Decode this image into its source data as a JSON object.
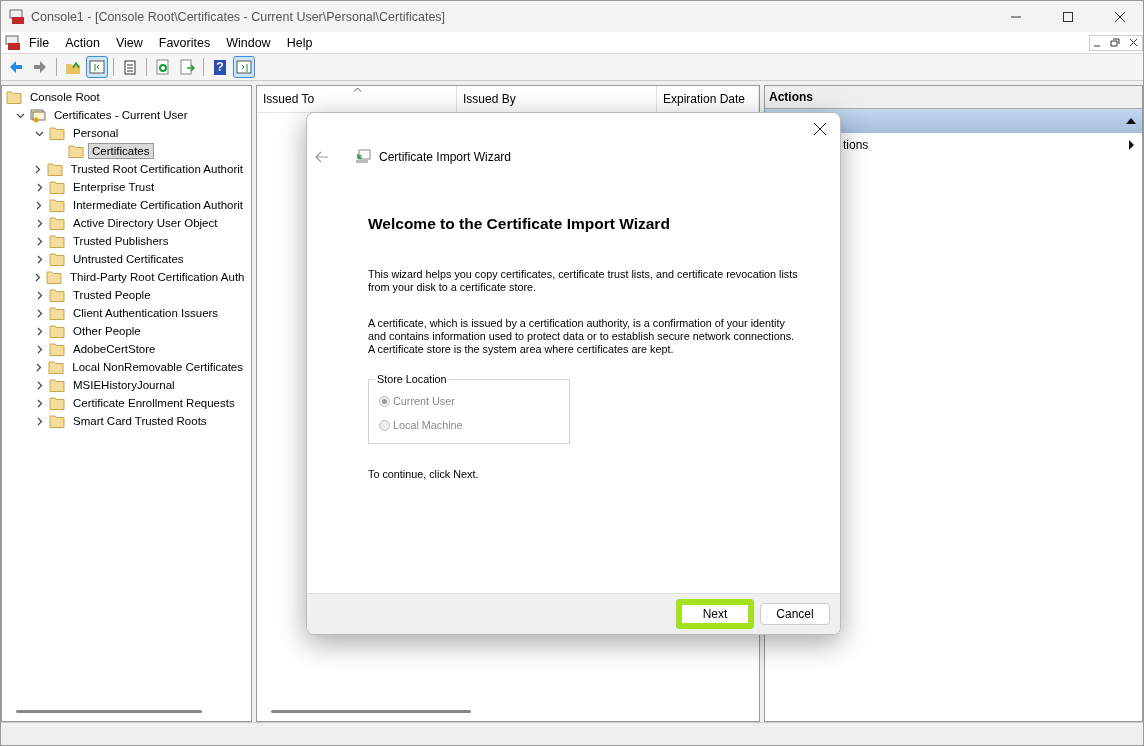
{
  "window": {
    "title": "Console1 - [Console Root\\Certificates - Current User\\Personal\\Certificates]"
  },
  "menu": [
    "File",
    "Action",
    "View",
    "Favorites",
    "Window",
    "Help"
  ],
  "toolbar": [
    {
      "kind": "back",
      "pressed": false
    },
    {
      "kind": "forward",
      "pressed": false
    },
    {
      "kind": "up",
      "pressed": false
    },
    {
      "kind": "tree",
      "pressed": true
    },
    {
      "kind": "clipboard",
      "pressed": false
    },
    {
      "kind": "refresh",
      "pressed": false
    },
    {
      "kind": "export",
      "pressed": false
    },
    {
      "kind": "help",
      "pressed": false,
      "glyph": "?"
    },
    {
      "kind": "pane",
      "pressed": true
    }
  ],
  "tree": [
    {
      "label": "Console Root",
      "kind": "folder",
      "selected": false,
      "children": [
        {
          "label": "Certificates - Current User",
          "kind": "store",
          "expanded": true,
          "selected": false,
          "children": [
            {
              "label": "Personal",
              "kind": "folder",
              "expanded": true,
              "selected": false,
              "children": [
                {
                  "label": "Certificates",
                  "kind": "folder",
                  "selected": true
                }
              ]
            },
            {
              "label": "Trusted Root Certification Authorit",
              "kind": "folder",
              "expanded": false,
              "selected": false
            },
            {
              "label": "Enterprise Trust",
              "kind": "folder",
              "expanded": false,
              "selected": false
            },
            {
              "label": "Intermediate Certification Authorit",
              "kind": "folder",
              "expanded": false,
              "selected": false
            },
            {
              "label": "Active Directory User Object",
              "kind": "folder",
              "expanded": false,
              "selected": false
            },
            {
              "label": "Trusted Publishers",
              "kind": "folder",
              "expanded": false,
              "selected": false
            },
            {
              "label": "Untrusted Certificates",
              "kind": "folder",
              "expanded": false,
              "selected": false
            },
            {
              "label": "Third-Party Root Certification Auth",
              "kind": "folder",
              "expanded": false,
              "selected": false
            },
            {
              "label": "Trusted People",
              "kind": "folder",
              "expanded": false,
              "selected": false
            },
            {
              "label": "Client Authentication Issuers",
              "kind": "folder",
              "expanded": false,
              "selected": false
            },
            {
              "label": "Other People",
              "kind": "folder",
              "expanded": false,
              "selected": false
            },
            {
              "label": "AdobeCertStore",
              "kind": "folder",
              "expanded": false,
              "selected": false
            },
            {
              "label": "Local NonRemovable Certificates",
              "kind": "folder",
              "expanded": false,
              "selected": false
            },
            {
              "label": "MSIEHistoryJournal",
              "kind": "folder",
              "expanded": false,
              "selected": false
            },
            {
              "label": "Certificate Enrollment Requests",
              "kind": "folder",
              "expanded": false,
              "selected": false
            },
            {
              "label": "Smart Card Trusted Roots",
              "kind": "folder",
              "expanded": false,
              "selected": false
            }
          ]
        }
      ]
    }
  ],
  "table": {
    "columns": [
      {
        "label": "Issued To",
        "sorted": true
      },
      {
        "label": "Issued By",
        "sorted": false
      },
      {
        "label": "Expiration Date",
        "sorted": false
      }
    ]
  },
  "actions": {
    "title": "Actions",
    "items": [
      {
        "kind": "section",
        "expanded": true
      },
      {
        "label": "tions",
        "kind": "submenu"
      }
    ]
  },
  "dialog": {
    "title": "Certificate Import Wizard",
    "heading": "Welcome to the Certificate Import Wizard",
    "paragraphs": [
      "This wizard helps you copy certificates, certificate trust lists, and certificate revocation lists from your disk to a certificate store.",
      "A certificate, which is issued by a certification authority, is a confirmation of your identity and contains information used to protect data or to establish secure network connections. A certificate store is the system area where certificates are kept."
    ],
    "store_location": {
      "label": "Store Location",
      "options": [
        {
          "label": "Current User",
          "selected": true,
          "disabled": true
        },
        {
          "label": "Local Machine",
          "selected": false,
          "disabled": true
        }
      ]
    },
    "footer_text": "To continue, click Next.",
    "buttons": [
      {
        "label": "Next",
        "default": true,
        "highlighted": true
      },
      {
        "label": "Cancel",
        "default": false,
        "highlighted": false
      }
    ]
  }
}
